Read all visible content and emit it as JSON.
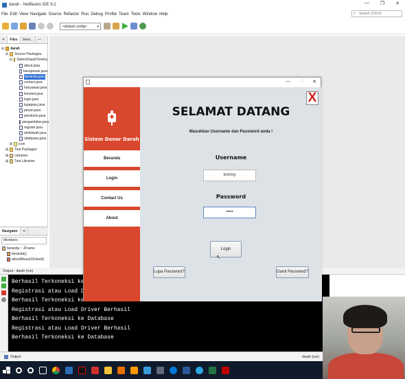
{
  "app": {
    "title": "darah - NetBeans IDE 8.2"
  },
  "menu": [
    "File",
    "Edit",
    "View",
    "Navigate",
    "Source",
    "Refactor",
    "Run",
    "Debug",
    "Profile",
    "Team",
    "Tools",
    "Window",
    "Help"
  ],
  "search": {
    "placeholder": "Search (Ctrl+I)"
  },
  "toolbar": {
    "config_value": "<default config>"
  },
  "left_tabs": [
    "Files",
    "Servi..."
  ],
  "project": {
    "name": "darah",
    "source_packages": "Source Packages",
    "package": "SistemDarahTommy",
    "files": [
      "about.java",
      "bacapesan.java",
      "beranda.java",
      "contact.java",
      "hanyawan.java",
      "koneksi.java",
      "login.java",
      "lupapass.java",
      "pesan.java",
      "pendonor.java",
      "pengambilan.java",
      "register.java",
      "stokdarah.java",
      "ubahpass.java"
    ],
    "selected_file": "beranda.java",
    "icon_folder": "icon",
    "test_packages": "Test Packages",
    "libraries": "Libraries",
    "test_libraries": "Test Libraries"
  },
  "navigator": {
    "title": "Navigator",
    "filter": "Members",
    "items": [
      "beranda :: JFrame",
      "beranda()",
      "aboutMouseClicked()"
    ]
  },
  "output": {
    "title": "Output - darah (run)",
    "lines": [
      "Berhasil Terkoneksi ke Database",
      "Registrasi atau Load Driver Berhasil",
      "Berhasil Terkoneksi ke Database",
      "Registrasi atau Load Driver Berhasil",
      "Berhasil Terkoneksi ke Database",
      "Registrasi atau Load Driver Berhasil",
      "Berhasil Terkoneksi ke Database"
    ]
  },
  "status": {
    "output_tab": "Output",
    "run_status": "darah (run)"
  },
  "dialog": {
    "brand": "Sistem Donor Darah",
    "nav": [
      "Beranda",
      "Login",
      "Contact Us",
      "About"
    ],
    "close_label": "X",
    "welcome": "SELAMAT DATANG",
    "subtitle": "Masukkan Username dan Password anda !",
    "username_label": "Username",
    "username_value": "tommy",
    "password_label": "Password",
    "password_value": "•••••",
    "login_button": "Login",
    "forgot_button": "Lupa Password?",
    "change_button": "Ganti Password?"
  },
  "colors": {
    "accent": "#d9472c",
    "selection": "#2f6fd6",
    "console_bg": "#000000",
    "close": "#d41f1f"
  },
  "taskbar": {
    "icons": [
      "windows-icon",
      "search-icon",
      "cortana-icon",
      "taskview-icon",
      "chrome-icon",
      "netbeans-icon",
      "netflix-icon",
      "adobe-icon",
      "explorer-icon",
      "java-icon",
      "sublime-icon",
      "paint-icon",
      "camera-icon",
      "edge-icon",
      "word-icon",
      "telegram-icon",
      "excel-icon",
      "filezilla-icon"
    ]
  }
}
